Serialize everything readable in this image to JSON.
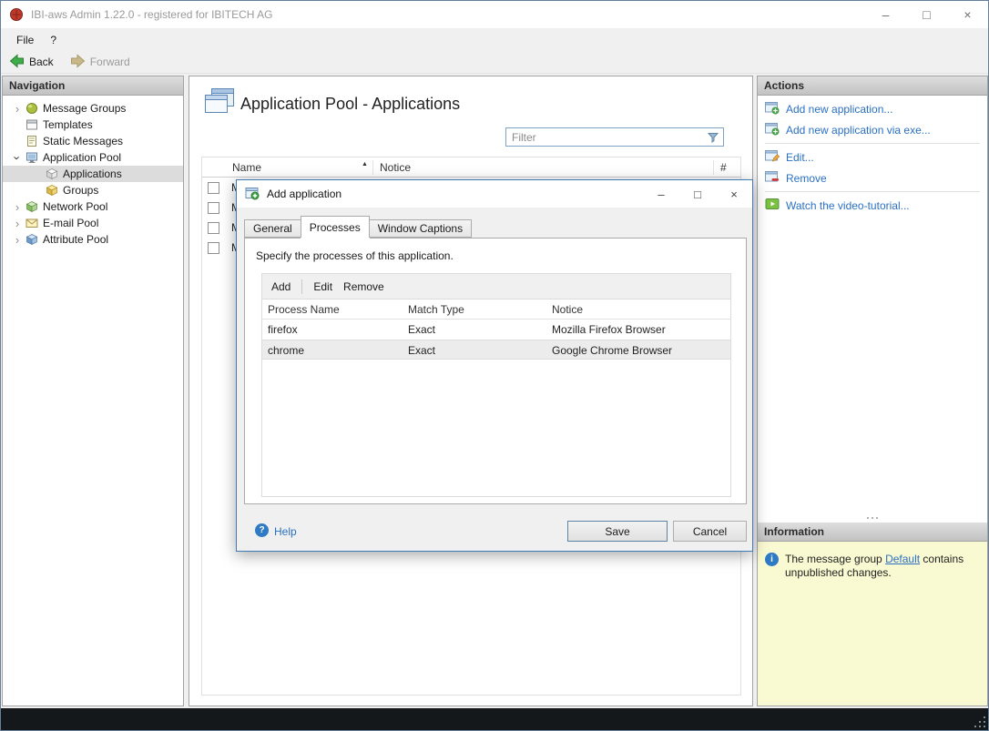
{
  "window": {
    "title": "IBI-aws Admin 1.22.0 - registered for IBITECH AG",
    "controls": {
      "minimize": "–",
      "maximize": "□",
      "close": "×"
    }
  },
  "menubar": {
    "items": [
      {
        "label": "File"
      },
      {
        "label": "?"
      }
    ]
  },
  "toolbar": {
    "back_label": "Back",
    "forward_label": "Forward"
  },
  "navigation": {
    "header": "Navigation",
    "items": [
      {
        "label": "Message Groups",
        "state": "collapsed"
      },
      {
        "label": "Templates",
        "state": "leaf"
      },
      {
        "label": "Static Messages",
        "state": "leaf"
      },
      {
        "label": "Application Pool",
        "state": "expanded"
      },
      {
        "label": "Applications",
        "state": "leaf",
        "selected": true
      },
      {
        "label": "Groups",
        "state": "leaf"
      },
      {
        "label": "Network Pool",
        "state": "collapsed"
      },
      {
        "label": "E-mail Pool",
        "state": "collapsed"
      },
      {
        "label": "Attribute Pool",
        "state": "collapsed"
      }
    ]
  },
  "main": {
    "title": "Application Pool - Applications",
    "filter": {
      "placeholder": "Filter"
    },
    "table": {
      "columns": {
        "name": "Name",
        "notice": "Notice",
        "number": "#"
      },
      "sort_column": "Name",
      "rows": [
        {
          "name": "M"
        },
        {
          "name": "M"
        },
        {
          "name": "M"
        },
        {
          "name": "M"
        }
      ]
    }
  },
  "dialog": {
    "title": "Add application",
    "controls": {
      "minimize": "–",
      "maximize": "□",
      "close": "×"
    },
    "tabs": [
      {
        "label": "General",
        "active": false
      },
      {
        "label": "Processes",
        "active": true
      },
      {
        "label": "Window Captions",
        "active": false
      }
    ],
    "description": "Specify the processes of this application.",
    "toolbar": {
      "add": "Add",
      "edit": "Edit",
      "remove": "Remove"
    },
    "table": {
      "columns": {
        "process_name": "Process Name",
        "match_type": "Match Type",
        "notice": "Notice"
      },
      "rows": [
        {
          "process_name": "firefox",
          "match_type": "Exact",
          "notice": "Mozilla Firefox Browser",
          "selected": false
        },
        {
          "process_name": "chrome",
          "match_type": "Exact",
          "notice": "Google Chrome Browser",
          "selected": true
        }
      ]
    },
    "help_label": "Help",
    "buttons": {
      "save": "Save",
      "cancel": "Cancel"
    }
  },
  "actions": {
    "header": "Actions",
    "items": [
      {
        "label": "Add new application..."
      },
      {
        "label": "Add new application via exe..."
      },
      {
        "label": "Edit..."
      },
      {
        "label": "Remove"
      },
      {
        "label": "Watch the video-tutorial..."
      }
    ]
  },
  "information": {
    "header": "Information",
    "message": {
      "text_before": "The message group ",
      "link": "Default",
      "text_after": " contains unpublished changes."
    }
  },
  "icons": {
    "chevron": "›",
    "sort_asc": "▲",
    "help_glyph": "?",
    "info_glyph": "i"
  },
  "colors": {
    "link_blue": "#2a70c2",
    "selection_gray": "#dcdcdc",
    "info_panel_yellow": "#fafad2",
    "status_bar_dark": "#14181b",
    "dialog_border_blue": "#3f7cb6"
  }
}
